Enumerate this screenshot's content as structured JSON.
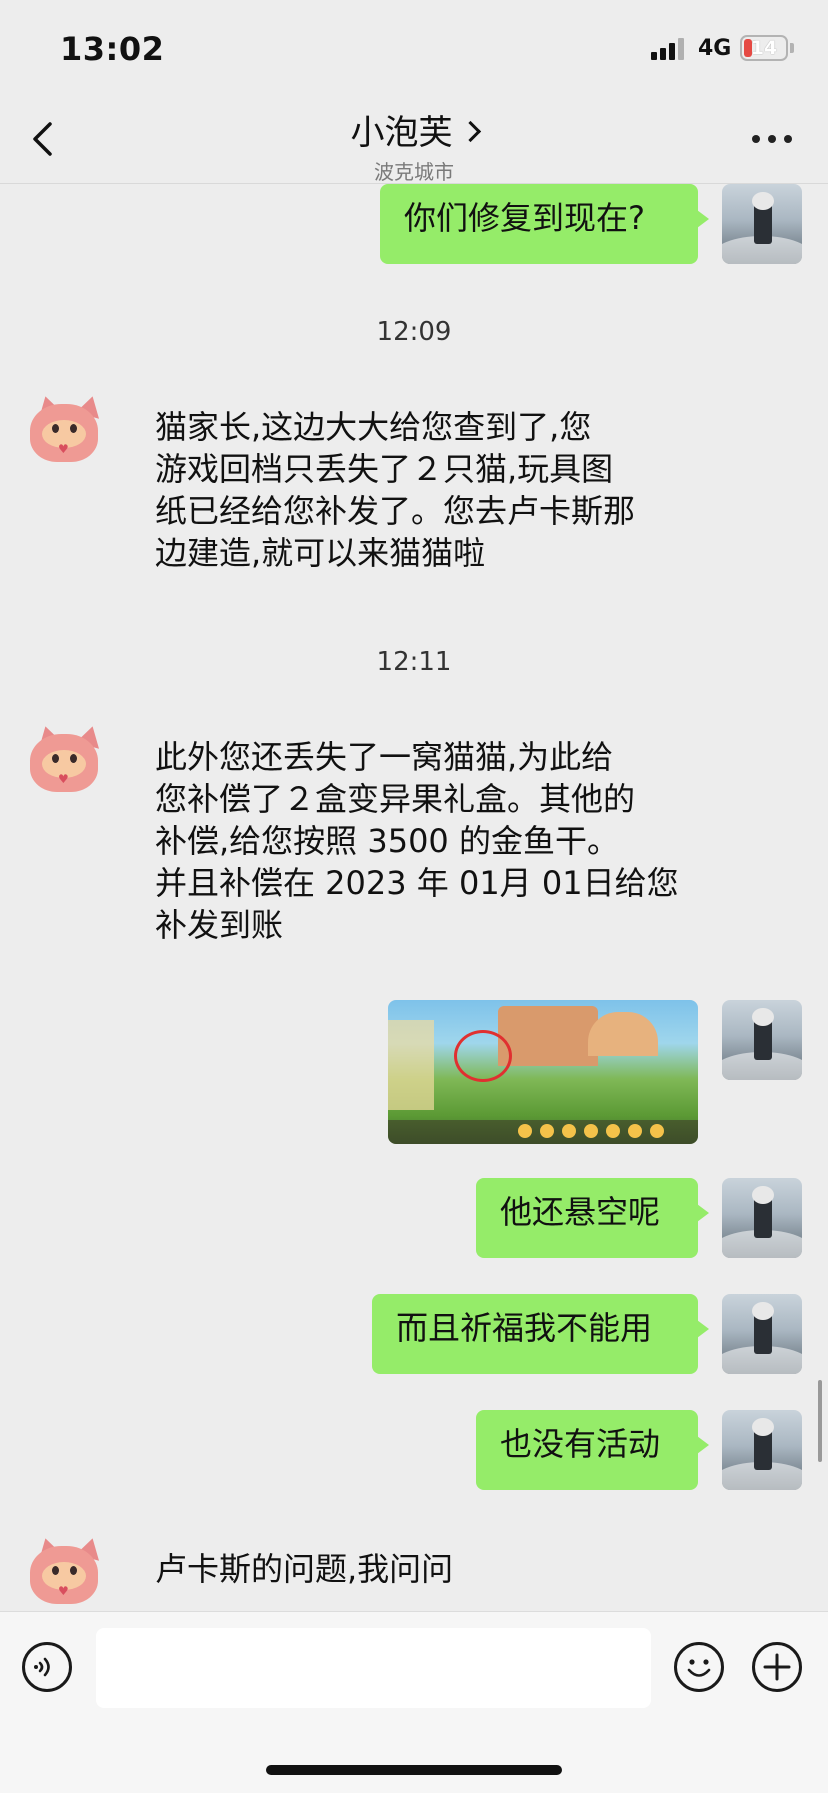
{
  "status_bar": {
    "time": "13:02",
    "network": "4G",
    "battery_level": "14"
  },
  "nav": {
    "title": "小泡芙",
    "subtitle": "波克城市"
  },
  "messages": [
    {
      "from": "me",
      "text": "你们修复到现在?"
    },
    {
      "type": "timestamp",
      "text": "12:09"
    },
    {
      "from": "other",
      "lines": [
        "猫家长,这边大大给您查到了,您",
        "游戏回档只丢失了２只猫,玩具图",
        "纸已经给您补发了。您去卢卡斯那",
        "边建造,就可以来猫猫啦"
      ]
    },
    {
      "type": "timestamp",
      "text": "12:11"
    },
    {
      "from": "other",
      "lines": [
        "此外您还丢失了一窝猫猫,为此给",
        "您补偿了２盒变异果礼盒。其他的",
        "补偿,给您按照 3500 的金鱼干。",
        "并且补偿在 2023 年 01月 01日给您",
        "补发到账"
      ]
    },
    {
      "from": "me",
      "type": "image"
    },
    {
      "from": "me",
      "text": "他还悬空呢"
    },
    {
      "from": "me",
      "text": "而且祈福我不能用"
    },
    {
      "from": "me",
      "text": "也没有活动"
    },
    {
      "from": "other",
      "text": "卢卡斯的问题,我问问"
    }
  ],
  "input": {
    "placeholder": ""
  }
}
